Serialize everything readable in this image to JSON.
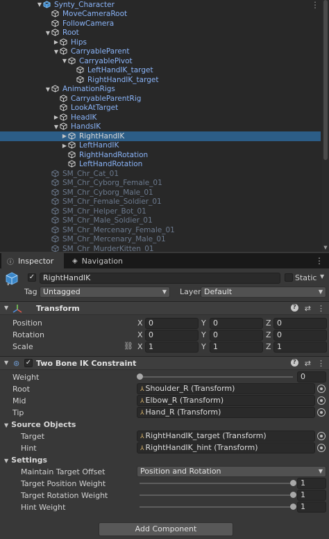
{
  "hierarchy": {
    "items": [
      {
        "label": "Synty_Character",
        "depth": 0,
        "arrow": "down",
        "icon": "prefab-cube-icon",
        "style": "blue"
      },
      {
        "label": "MoveCameraRoot",
        "depth": 1,
        "arrow": "none",
        "icon": "gameobject-cube-icon",
        "style": "blue"
      },
      {
        "label": "FollowCamera",
        "depth": 1,
        "arrow": "none",
        "icon": "gameobject-cube-icon",
        "style": "blue"
      },
      {
        "label": "Root",
        "depth": 1,
        "arrow": "down",
        "icon": "gameobject-cube-icon",
        "style": "blue"
      },
      {
        "label": "Hips",
        "depth": 2,
        "arrow": "right",
        "icon": "gameobject-cube-icon",
        "style": "blue"
      },
      {
        "label": "CarryableParent",
        "depth": 2,
        "arrow": "down",
        "icon": "gameobject-cube-icon",
        "style": "blue"
      },
      {
        "label": "CarryablePivot",
        "depth": 3,
        "arrow": "down",
        "icon": "gameobject-cube-icon",
        "style": "blue"
      },
      {
        "label": "LeftHandIK_target",
        "depth": 4,
        "arrow": "none",
        "icon": "gameobject-cube-icon",
        "style": "blue"
      },
      {
        "label": "RightHandIK_target",
        "depth": 4,
        "arrow": "none",
        "icon": "gameobject-cube-icon",
        "style": "blue"
      },
      {
        "label": "AnimationRigs",
        "depth": 1,
        "arrow": "down",
        "icon": "gameobject-cube-icon",
        "style": "blue"
      },
      {
        "label": "CarryableParentRig",
        "depth": 2,
        "arrow": "none",
        "icon": "gameobject-cube-icon",
        "style": "blue"
      },
      {
        "label": "LookAtTarget",
        "depth": 2,
        "arrow": "none",
        "icon": "gameobject-cube-icon",
        "style": "blue"
      },
      {
        "label": "HeadIK",
        "depth": 2,
        "arrow": "right",
        "icon": "gameobject-cube-icon",
        "style": "blue"
      },
      {
        "label": "HandsIK",
        "depth": 2,
        "arrow": "down",
        "icon": "gameobject-cube-icon",
        "style": "blue"
      },
      {
        "label": "RightHandIK",
        "depth": 3,
        "arrow": "right",
        "icon": "gameobject-cube-icon",
        "style": "selected"
      },
      {
        "label": "LeftHandIK",
        "depth": 3,
        "arrow": "right",
        "icon": "gameobject-cube-icon",
        "style": "blue"
      },
      {
        "label": "RightHandRotation",
        "depth": 3,
        "arrow": "none",
        "icon": "gameobject-cube-icon",
        "style": "blue"
      },
      {
        "label": "LeftHandRotation",
        "depth": 3,
        "arrow": "none",
        "icon": "gameobject-cube-icon",
        "style": "blue"
      },
      {
        "label": "SM_Chr_Cat_01",
        "depth": 1,
        "arrow": "none",
        "icon": "gameobject-cube-icon",
        "style": "dim"
      },
      {
        "label": "SM_Chr_Cyborg_Female_01",
        "depth": 1,
        "arrow": "none",
        "icon": "gameobject-cube-icon",
        "style": "dim"
      },
      {
        "label": "SM_Chr_Cyborg_Male_01",
        "depth": 1,
        "arrow": "none",
        "icon": "gameobject-cube-icon",
        "style": "dim"
      },
      {
        "label": "SM_Chr_Female_Soldier_01",
        "depth": 1,
        "arrow": "none",
        "icon": "gameobject-cube-icon",
        "style": "dim"
      },
      {
        "label": "SM_Chr_Helper_Bot_01",
        "depth": 1,
        "arrow": "none",
        "icon": "gameobject-cube-icon",
        "style": "dim"
      },
      {
        "label": "SM_Chr_Male_Soldier_01",
        "depth": 1,
        "arrow": "none",
        "icon": "gameobject-cube-icon",
        "style": "dim"
      },
      {
        "label": "SM_Chr_Mercenary_Female_01",
        "depth": 1,
        "arrow": "none",
        "icon": "gameobject-cube-icon",
        "style": "dim"
      },
      {
        "label": "SM_Chr_Mercenary_Male_01",
        "depth": 1,
        "arrow": "none",
        "icon": "gameobject-cube-icon",
        "style": "dim"
      },
      {
        "label": "SM_Chr_MurderKitten_01",
        "depth": 1,
        "arrow": "none",
        "icon": "gameobject-cube-icon",
        "style": "dim"
      }
    ],
    "colors": {
      "selected": "#2c5d87",
      "label_blue": "#8ab4f8",
      "label_dim": "#6c7a8e"
    }
  },
  "tabs": {
    "inspector": "Inspector",
    "navigation": "Navigation",
    "inspector_icon": "info-icon",
    "navigation_icon": "navigation-icon"
  },
  "object": {
    "active": true,
    "name": "RightHandIK",
    "static_label": "Static",
    "tag_label": "Tag",
    "tag_value": "Untagged",
    "layer_label": "Layer",
    "layer_value": "Default"
  },
  "transform": {
    "title": "Transform",
    "position_label": "Position",
    "rotation_label": "Rotation",
    "scale_label": "Scale",
    "axis_x": "X",
    "axis_y": "Y",
    "axis_z": "Z",
    "position": {
      "x": "0",
      "y": "0",
      "z": "0"
    },
    "rotation": {
      "x": "0",
      "y": "0",
      "z": "0"
    },
    "scale": {
      "x": "1",
      "y": "1",
      "z": "1"
    }
  },
  "ik": {
    "title": "Two Bone IK Constraint",
    "enabled": true,
    "weight_label": "Weight",
    "weight_value": "0",
    "weight_fraction": 0,
    "root_label": "Root",
    "root_value": "Shoulder_R (Transform)",
    "mid_label": "Mid",
    "mid_value": "Elbow_R (Transform)",
    "tip_label": "Tip",
    "tip_value": "Hand_R (Transform)",
    "source_objects_label": "Source Objects",
    "target_label": "Target",
    "target_value": "RightHandIK_target (Transform)",
    "hint_label": "Hint",
    "hint_value": "RightHandIK_hint (Transform)",
    "settings_label": "Settings",
    "mto_label": "Maintain Target Offset",
    "mto_value": "Position and Rotation",
    "tpw_label": "Target Position Weight",
    "tpw_value": "1",
    "tpw_fraction": 1,
    "trw_label": "Target Rotation Weight",
    "trw_value": "1",
    "trw_fraction": 1,
    "hw_label": "Hint Weight",
    "hw_value": "1",
    "hw_fraction": 1
  },
  "footer": {
    "add_component": "Add Component"
  },
  "accent_color": "#e8c070"
}
